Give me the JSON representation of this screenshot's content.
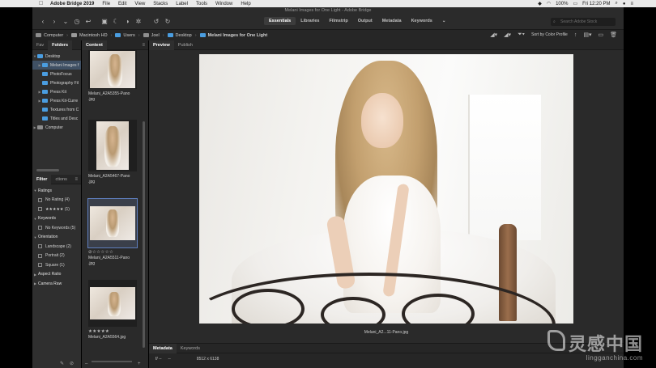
{
  "menubar": {
    "app": "Adobe Bridge 2019",
    "items": [
      "File",
      "Edit",
      "View",
      "Stacks",
      "Label",
      "Tools",
      "Window",
      "Help"
    ],
    "battery": "100%",
    "clock": "Fri 12:20 PM"
  },
  "window": {
    "title": "Melani Images for One Light - Adobe Bridge"
  },
  "toolbar": {
    "workspaces": [
      "Essentials",
      "Libraries",
      "Filmstrip",
      "Output",
      "Metadata",
      "Keywords"
    ],
    "active_workspace": "Essentials",
    "search_placeholder": "Search Adobe Stock"
  },
  "pathbar": {
    "crumbs": [
      "Computer",
      "Macintosh HD",
      "Users",
      "Joel",
      "Desktop",
      "Melani Images for One Light"
    ],
    "sort_label": "Sort by Color Profile"
  },
  "left_panel": {
    "tabs": [
      "Fav",
      "Folders"
    ],
    "active_tab": "Folders",
    "tree": [
      {
        "label": "Desktop"
      },
      {
        "label": "Melani Images f"
      },
      {
        "label": "PhotoFocus"
      },
      {
        "label": "Photography Fil"
      },
      {
        "label": "Press Kit"
      },
      {
        "label": "Press Kit-Curre"
      },
      {
        "label": "Textures from C"
      },
      {
        "label": "Titles and Desc"
      },
      {
        "label": "Computer"
      }
    ],
    "filter_tabs": [
      "Filter",
      "ctions"
    ],
    "filters": {
      "ratings_title": "Ratings",
      "no_rating": "No Rating",
      "no_rating_count": "(4)",
      "five_star": "★★★★★",
      "five_star_count": "(1)",
      "keywords_title": "Keywords",
      "no_keywords": "No Keywords",
      "no_keywords_count": "(5)",
      "orientation_title": "Orientation",
      "landscape": "Landscape",
      "landscape_count": "(2)",
      "portrait": "Portrait",
      "portrait_count": "(2)",
      "square": "Square",
      "square_count": "(1)",
      "aspect_title": "Aspect Ratio",
      "camera_title": "Camera Raw"
    }
  },
  "content": {
    "tab": "Content",
    "items": [
      {
        "name": "Melani_A2A5355-Pano",
        "ext": ".jpg"
      },
      {
        "name": "Melani_A2A5467-Pano",
        "ext": ".jpg"
      },
      {
        "name": "Melani_A2A5511-Pano",
        "ext": ".jpg",
        "stars": "⊘☆☆☆☆☆"
      },
      {
        "name": "Melani_A2A5564.jpg",
        "stars": "★★★★★"
      }
    ]
  },
  "preview": {
    "tabs": [
      "Preview",
      "Publish"
    ],
    "active_tab": "Preview",
    "caption": "Melani_A2...11-Pano.jpg"
  },
  "metadata": {
    "tabs": [
      "Metadata",
      "Keywords"
    ],
    "active_tab": "Metadata",
    "fstop": "f/ --",
    "dash": "--",
    "dimensions": "8512 x 6138"
  },
  "watermark": {
    "big": "灵感中国",
    "small": "lingganchina.com"
  }
}
